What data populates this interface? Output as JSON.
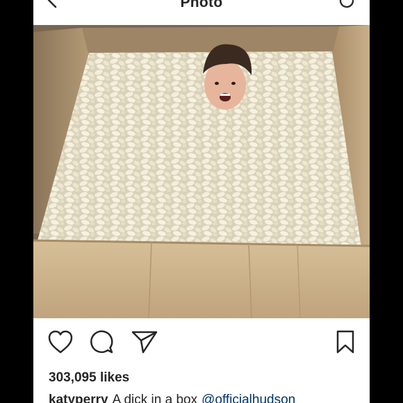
{
  "header": {
    "title": "Photo",
    "back_icon": "chevron-left-icon",
    "refresh_icon": "refresh-icon"
  },
  "post": {
    "image_alt": "Man's head sticking out of a cardboard box full of packing peanuts",
    "likes_text": "303,095 likes",
    "caption": {
      "username": "katyperry",
      "text": "A dick in a box",
      "mention": "@officialhudson"
    }
  },
  "actions": {
    "like_icon": "heart-icon",
    "comment_icon": "comment-icon",
    "share_icon": "paper-plane-icon",
    "save_icon": "bookmark-icon"
  },
  "colors": {
    "background": "#000000",
    "screen": "#ffffff",
    "text": "#262626",
    "mention": "#003569"
  }
}
